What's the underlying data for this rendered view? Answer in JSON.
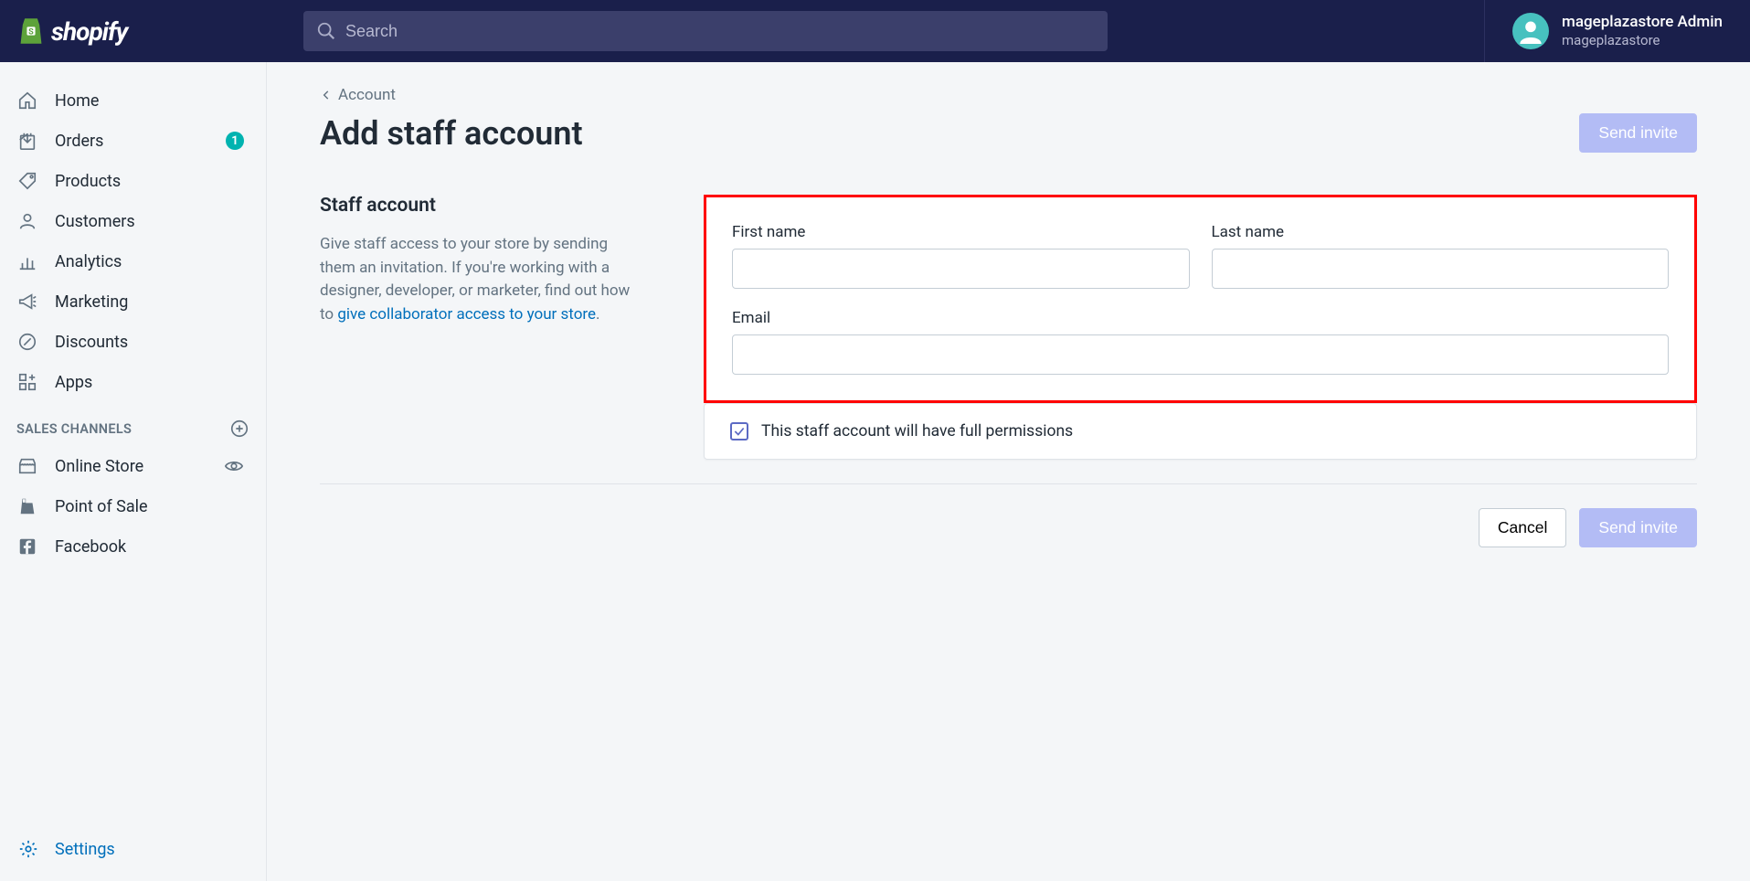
{
  "header": {
    "logo_text": "shopify",
    "search_placeholder": "Search",
    "user_name": "mageplazastore Admin",
    "user_store": "mageplazastore"
  },
  "sidebar": {
    "items": [
      {
        "label": "Home"
      },
      {
        "label": "Orders",
        "badge": "1"
      },
      {
        "label": "Products"
      },
      {
        "label": "Customers"
      },
      {
        "label": "Analytics"
      },
      {
        "label": "Marketing"
      },
      {
        "label": "Discounts"
      },
      {
        "label": "Apps"
      }
    ],
    "section_label": "SALES CHANNELS",
    "channels": [
      {
        "label": "Online Store"
      },
      {
        "label": "Point of Sale"
      },
      {
        "label": "Facebook"
      }
    ],
    "settings_label": "Settings"
  },
  "main": {
    "breadcrumb": "Account",
    "page_title": "Add staff account",
    "send_invite_label": "Send invite",
    "cancel_label": "Cancel",
    "section_title": "Staff account",
    "section_desc_1": "Give staff access to your store by sending them an invitation. If you're working with a designer, developer, or marketer, find out how to ",
    "section_link": "give collaborator access to your store",
    "section_desc_2": ".",
    "form": {
      "first_name_label": "First name",
      "last_name_label": "Last name",
      "email_label": "Email",
      "first_name_value": "",
      "last_name_value": "",
      "email_value": ""
    },
    "permissions_label": "This staff account will have full permissions"
  }
}
